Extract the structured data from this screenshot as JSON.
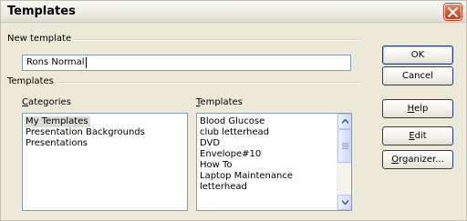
{
  "window": {
    "title": "Templates"
  },
  "new_template": {
    "group_label": "New template",
    "name_value": "Rons Normal"
  },
  "templates_group": {
    "group_label": "Templates",
    "categories_label_prefix": "",
    "categories_label_accel": "C",
    "categories_label_rest": "ategories",
    "templates_label_accel": "T",
    "templates_label_rest": "emplates",
    "categories": [
      "My Templates",
      "Presentation Backgrounds",
      "Presentations"
    ],
    "selected_category": "My Templates",
    "templates": [
      "Blood Glucose",
      "club letterhead",
      "DVD",
      "Envelope#10",
      "How To",
      "Laptop Maintenance",
      "letterhead"
    ]
  },
  "buttons": {
    "ok": "OK",
    "cancel": "Cancel",
    "help_accel": "H",
    "help_rest": "elp",
    "edit_accel": "E",
    "edit_rest": "dit",
    "organizer_accel": "O",
    "organizer_rest": "rganizer..."
  },
  "colors": {
    "dialog_bg": "#ece9d8",
    "input_border": "#7f9db9",
    "button_border": "#1e3c78",
    "close_button": "#d4542f",
    "selection": "#dcdcd6"
  }
}
